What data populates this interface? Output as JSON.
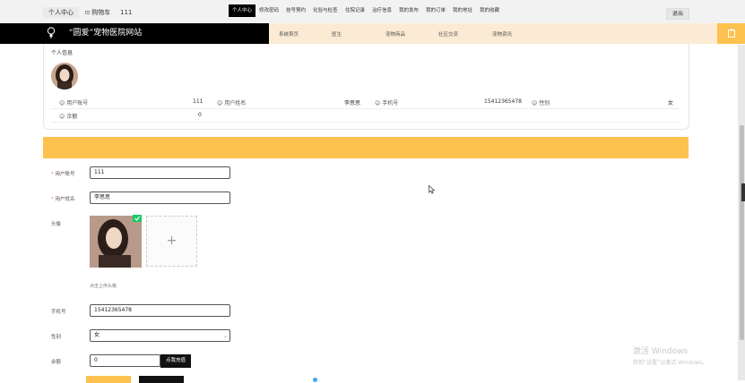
{
  "topbar": {
    "personal_center": "个人中心",
    "cart_label": "购物车",
    "username": "111",
    "logout": "退出"
  },
  "header": {
    "site_title": "“圆爱”宠物医院网站",
    "nav": [
      "系统首页",
      "医生",
      "宠物商品",
      "社区交流",
      "宠物资讯"
    ]
  },
  "profile_card": {
    "title": "个人信息",
    "fields": [
      {
        "label": "用户账号",
        "value": "111"
      },
      {
        "label": "用户姓名",
        "value": "李思思"
      },
      {
        "label": "手机号",
        "value": "15412365478"
      },
      {
        "label": "性别",
        "value": "女"
      },
      {
        "label": "余额",
        "value": "0"
      }
    ]
  },
  "tabs": {
    "items": [
      "个人中心",
      "修改密码",
      "挂号预约",
      "化验与检查",
      "住院记录",
      "治疗信息",
      "我的发布",
      "我的订单",
      "我的地址",
      "我的收藏"
    ],
    "active_index": 0
  },
  "form": {
    "account_label": "用户账号",
    "account_value": "111",
    "name_label": "用户姓名",
    "name_value": "李思思",
    "avatar_label": "头像",
    "avatar_hint": "点击上传头像",
    "add_glyph": "+",
    "phone_label": "手机号",
    "phone_value": "15412365478",
    "gender_label": "性别",
    "gender_value": "女",
    "balance_label": "余额",
    "balance_value": "0",
    "recharge_button": "点我充值"
  },
  "watermark": {
    "line1": "激活 Windows",
    "line2": "转到“设置”以激活 Windows。"
  },
  "colors": {
    "accent_yellow": "#fdc24e",
    "nav_bg": "#fbebd4",
    "header_black": "#000000",
    "check_green": "#13ce66"
  }
}
